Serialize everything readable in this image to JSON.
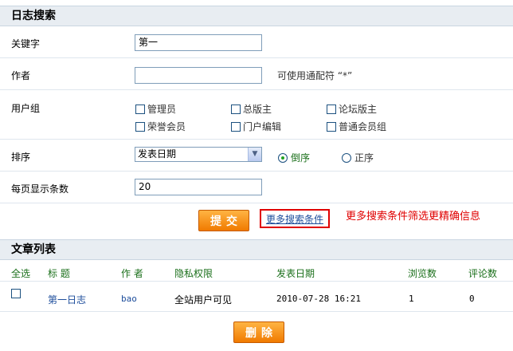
{
  "search": {
    "title": "日志搜索",
    "keyword_label": "关键字",
    "keyword_value": "第一",
    "author_label": "作者",
    "author_value": "",
    "author_hint": "可使用通配符 “*”",
    "group_label": "用户组",
    "groups": [
      "管理员",
      "总版主",
      "论坛版主",
      "荣誉会员",
      "门户编辑",
      "普通会员组"
    ],
    "sort_label": "排序",
    "sort_value": "发表日期",
    "sort_desc": "倒序",
    "sort_asc": "正序",
    "per_page_label": "每页显示条数",
    "per_page_value": "20",
    "submit_label": "提交",
    "more_conditions": "更多搜索条件",
    "annotation": "更多搜索条件筛选更精确信息"
  },
  "list": {
    "title": "文章列表",
    "columns": [
      "全选",
      "标 题",
      "作 者",
      "隐私权限",
      "发表日期",
      "浏览数",
      "评论数"
    ],
    "rows": [
      {
        "title": "第一日志",
        "author": "bao",
        "privacy": "全站用户可见",
        "date": "2010-07-28 16:21",
        "views": "1",
        "comments": "0"
      }
    ],
    "delete_label": "删除"
  },
  "colors": {
    "accent_orange": "#f07a00",
    "link_blue": "#1d4d9b",
    "header_green": "#1a6f1a",
    "annotation_red": "#e00000"
  }
}
